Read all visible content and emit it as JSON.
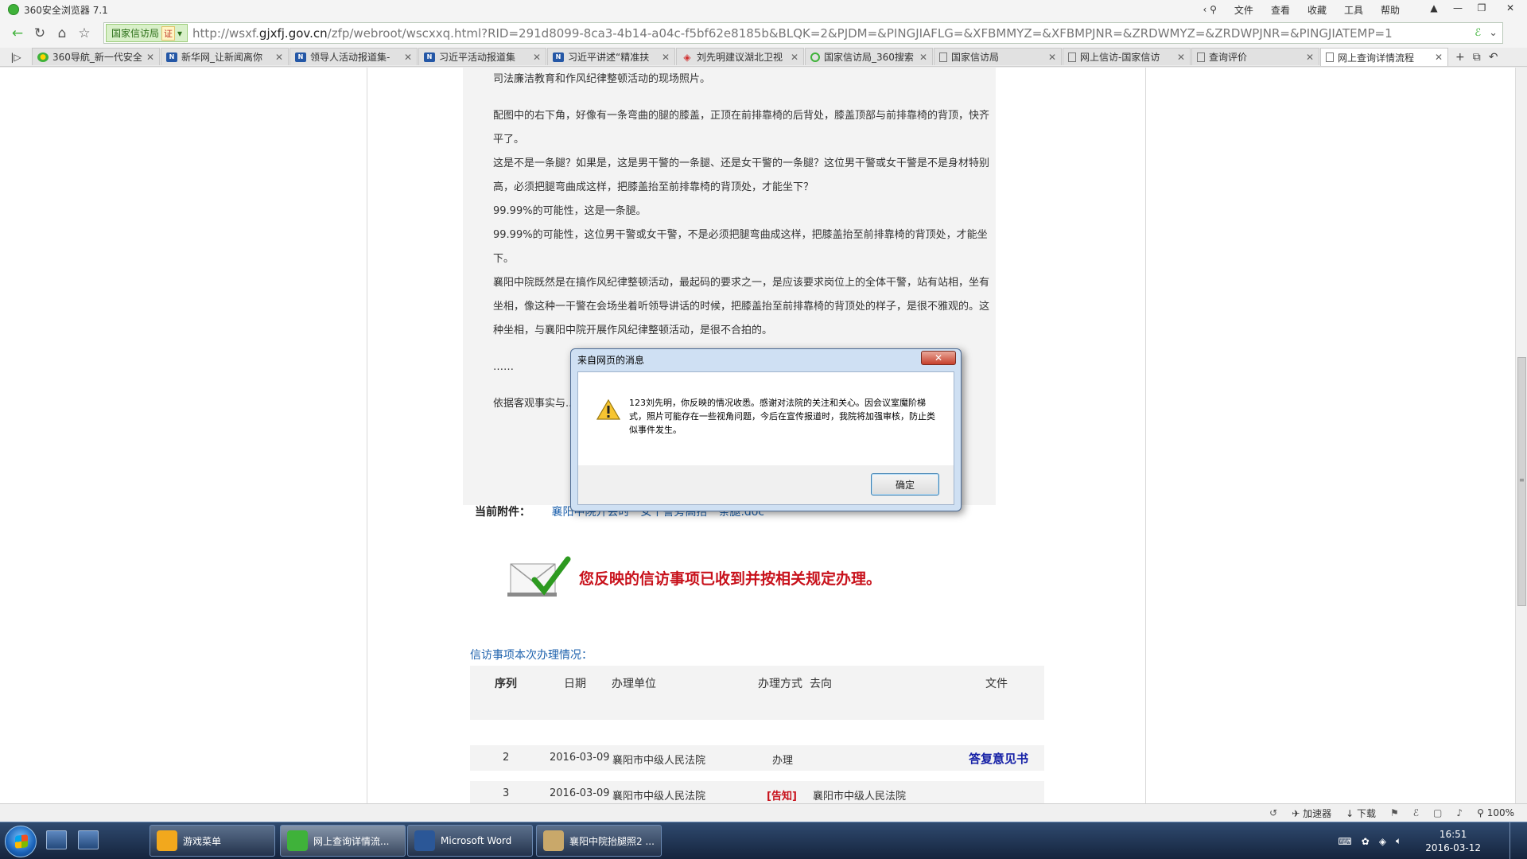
{
  "browser": {
    "title": "360安全浏览器 7.1",
    "menus": [
      "文件",
      "查看",
      "收藏",
      "工具",
      "帮助"
    ],
    "cert_label": "国家信访局",
    "cert_badge": "证",
    "url_prefix": "http://wsxf.",
    "url_domain": "gjxfj.gov.cn",
    "url_rest": "/zfp/webroot/wscxxq.html?RID=291d8099-8ca3-4b14-a04c-f5bf62e8185b&BLQK=2&PJDM=&PINGJIAFLG=&XFBMMYZ=&XFBMPJNR=&ZRDWMYZ=&ZRDWPJNR=&PINGJIATEMP=1",
    "tabs": [
      {
        "label": "360导航_新一代安全",
        "icon": "green"
      },
      {
        "label": "新华网_让新闻离你",
        "icon": "news"
      },
      {
        "label": "领导人活动报道集-",
        "icon": "news"
      },
      {
        "label": "习近平活动报道集",
        "icon": "news"
      },
      {
        "label": "习近平讲述“精准扶",
        "icon": "news"
      },
      {
        "label": "刘先明建议湖北卫视",
        "icon": "red"
      },
      {
        "label": "国家信访局_360搜索",
        "icon": "circle"
      },
      {
        "label": "国家信访局",
        "icon": "doc"
      },
      {
        "label": "网上信访-国家信访",
        "icon": "doc"
      },
      {
        "label": "查询评价",
        "icon": "doc"
      },
      {
        "label": "网上查询详情流程",
        "icon": "doc"
      }
    ],
    "status_items": [
      "加速器",
      "下载",
      "100%"
    ]
  },
  "article": {
    "paragraphs": [
      "司法廉洁教育和作风纪律整顿活动的现场照片。",
      "配图中的右下角，好像有一条弯曲的腿的膝盖，正顶在前排靠椅的后背处，膝盖顶部与前排靠椅的背顶，快齐平了。",
      "这是不是一条腿？如果是，这是男干警的一条腿、还是女干警的一条腿？这位男干警或女干警是不是身材特别高，必须把腿弯曲成这样，把膝盖抬至前排靠椅的背顶处，才能坐下？",
      "99.99%的可能性，这是一条腿。",
      "99.99%的可能性，这位男干警或女干警，不是必须把腿弯曲成这样，把膝盖抬至前排靠椅的背顶处，才能坐下。",
      "襄阳中院既然是在搞作风纪律整顿活动，最起码的要求之一，是应该要求岗位上的全体干警，站有站相，坐有坐相，像这种一干警在会场坐着听领导讲话的时候，把膝盖抬至前排靠椅的背顶处的样子，是很不雅观的。这种坐相，与襄阳中院开展作风纪律整顿活动，是很不合拍的。",
      "……",
      "依据客观事实与...下的襄阳中院的违法乱纪行...违法乱纪行为负主体责任吗？"
    ],
    "attachment_label": "当前附件：",
    "attachment_link": "襄阳中院开会时一女干警旁高抬一条腿.doc",
    "received_text": "您反映的信访事项已收到并按相关规定办理。",
    "handling_title": "信访事项本次办理情况：",
    "table_headers": [
      "序列",
      "日期",
      "办理单位",
      "办理方式",
      "去向",
      "文件"
    ],
    "rows": [
      {
        "seq": "2",
        "date": "2016-03-09",
        "unit": "襄阳市中级人民法院",
        "method": "办理",
        "dest": "",
        "file": "答复意见书"
      },
      {
        "seq": "3",
        "date": "2016-03-09",
        "unit": "襄阳市中级人民法院",
        "method": "[告知]",
        "dest": "襄阳市中级人民法院",
        "file": ""
      }
    ]
  },
  "dialog": {
    "title": "来自网页的消息",
    "message": "123刘先明，你反映的情况收悉。感谢对法院的关注和关心。因会议室魔阶梯式，照片可能存在一些视角问题，今后在宣传报道时，我院将加强审核，防止类似事件发生。",
    "ok_label": "确定"
  },
  "taskbar": {
    "buttons": [
      {
        "label": "游戏菜单",
        "color": "#f2a81d"
      },
      {
        "label": "网上查询详情流...",
        "color": "#3fb23a"
      },
      {
        "label": "Microsoft Word",
        "color": "#2b5797"
      },
      {
        "label": "襄阳中院抬腿照2 ...",
        "color": "#c9a86a"
      }
    ],
    "time": "16:51",
    "date": "2016-03-12"
  }
}
